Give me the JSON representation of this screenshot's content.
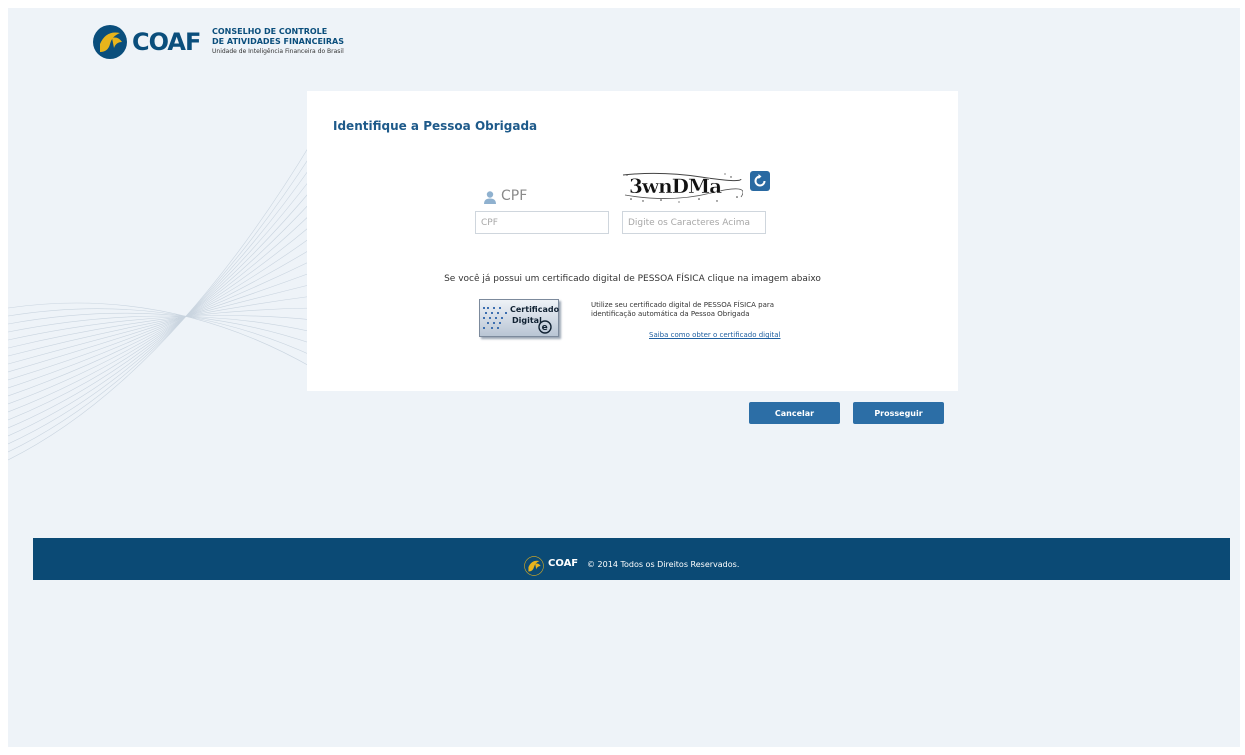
{
  "header": {
    "logo_text": "COAF",
    "org_line1": "CONSELHO DE CONTROLE",
    "org_line2": "DE ATIVIDADES FINANCEIRAS",
    "org_line3": "Unidade de Inteligência Financeira do Brasil"
  },
  "form": {
    "title": "Identifique a Pessoa Obrigada",
    "cpf_label": "CPF",
    "cpf_placeholder": "CPF",
    "captcha_text": "3wnDMa",
    "captcha_placeholder": "Digite os Caracteres Acima",
    "cert_hint": "Se você já possui um certificado digital de PESSOA FÍSICA clique na imagem abaixo",
    "cert_button_line1": "Certificado",
    "cert_button_line2": "Digital",
    "cert_desc": "Utilize seu certificado digital de PESSOA FÍSICA para identificação automática da Pessoa Obrigada",
    "cert_link": "Saiba como obter o certificado digital"
  },
  "actions": {
    "cancel": "Cancelar",
    "proceed": "Prosseguir"
  },
  "footer": {
    "logo_text": "COAF",
    "copyright": "© 2014 Todos os Direitos Reservados."
  },
  "colors": {
    "brand": "#0a4e7c",
    "button": "#2c6ea6",
    "footer": "#0b4a75",
    "logo_gold": "#e8b41c"
  }
}
